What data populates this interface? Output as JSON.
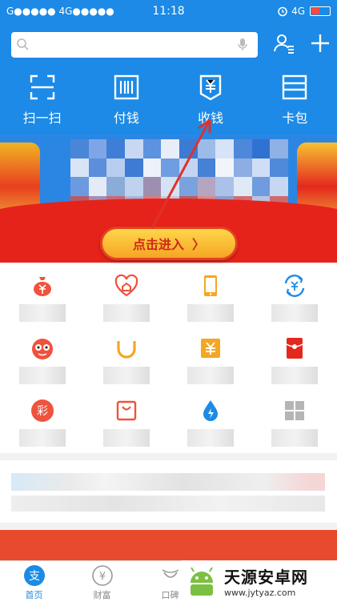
{
  "status_bar": {
    "carrier_left": "G●●●●● 4G●●●●●",
    "time": "11:18",
    "network_right": "4G"
  },
  "header": {
    "search_placeholder": "",
    "quick_actions": [
      {
        "label": "扫一扫",
        "icon": "scan-icon"
      },
      {
        "label": "付钱",
        "icon": "pay-icon"
      },
      {
        "label": "收钱",
        "icon": "receive-money-icon"
      },
      {
        "label": "卡包",
        "icon": "card-wallet-icon"
      }
    ]
  },
  "banner": {
    "enter_label": "点击进入",
    "enter_chevron": "〉"
  },
  "app_grid": [
    {
      "icon": "money-bag-icon",
      "color": "#f0523d"
    },
    {
      "icon": "heart-home-icon",
      "color": "#f0523d"
    },
    {
      "icon": "phone-icon",
      "color": "#f5a623"
    },
    {
      "icon": "currency-exchange-icon",
      "color": "#1c8ae6"
    },
    {
      "icon": "glasses-face-icon",
      "color": "#f0523d"
    },
    {
      "icon": "taxi-icon",
      "color": "#f5a623"
    },
    {
      "icon": "yuan-tag-icon",
      "color": "#f5a623"
    },
    {
      "icon": "red-envelope-icon",
      "color": "#e4281e"
    },
    {
      "icon": "lottery-icon",
      "color": "#f0523d",
      "glyph": "彩"
    },
    {
      "icon": "shopping-bag-icon",
      "color": "#f0523d"
    },
    {
      "icon": "water-drop-icon",
      "color": "#1c8ae6"
    },
    {
      "icon": "more-grid-icon",
      "color": "#b5b5b5"
    }
  ],
  "tabs": [
    {
      "label": "首页",
      "icon": "alipay-home-icon",
      "glyph": "支"
    },
    {
      "label": "财富",
      "icon": "wealth-icon",
      "glyph": "¥"
    },
    {
      "label": "口碑",
      "icon": "koubei-icon"
    }
  ],
  "watermark": {
    "title": "天源安卓网",
    "url": "www.jytyaz.com"
  },
  "colors": {
    "primary_blue": "#1c8ae6",
    "banner_red": "#e6231b",
    "accent_yellow": "#f5a623"
  }
}
